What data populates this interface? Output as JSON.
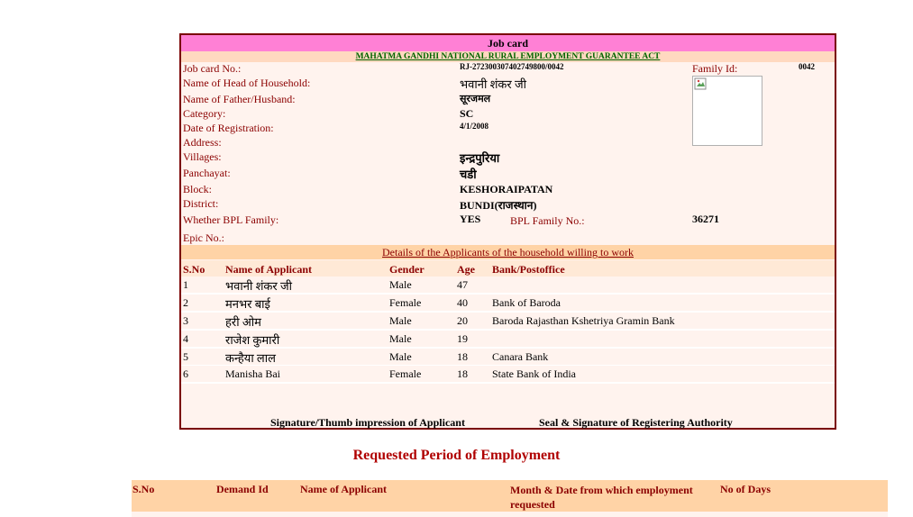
{
  "card": {
    "title": "Job card",
    "act": "MAHATMA GANDHI NATIONAL RURAL EMPLOYMENT GUARANTEE ACT",
    "labels": {
      "job_card_no": "Job card No.:",
      "head": "Name of Head of Household:",
      "father": "Name of Father/Husband:",
      "category": "Category:",
      "reg_date": "Date of Registration:",
      "address": "Address:",
      "villages": "Villages:",
      "panchayat": "Panchayat:",
      "block": "Block:",
      "district": "District:",
      "bpl": "Whether BPL Family:",
      "bpl_no": "BPL Family No.:",
      "epic": "Epic No.:",
      "family_id": "Family Id:"
    },
    "values": {
      "job_card_no": "RJ-272300307402749800/0042",
      "head": "भवानी शंकर जी",
      "father": "सूरजमल",
      "category": "SC",
      "reg_date": "4/1/2008",
      "villages": "इन्द्रपुरिया",
      "panchayat": "चडी",
      "block": "KESHORAIPATAN",
      "district": "BUNDI(राजस्थान)",
      "bpl": "YES",
      "bpl_no": "36271",
      "family_id": "0042"
    },
    "section_title": "Details of the Applicants of the household willing to work",
    "columns": [
      "S.No",
      "Name of Applicant",
      "Gender",
      "Age",
      "Bank/Postoffice"
    ],
    "applicants": [
      {
        "sno": "1",
        "name": "भवानी शंकर जी",
        "gender": "Male",
        "age": "47",
        "bank": ""
      },
      {
        "sno": "2",
        "name": "मनभर बाई",
        "gender": "Female",
        "age": "40",
        "bank": "Bank of Baroda"
      },
      {
        "sno": "3",
        "name": "हरी ओम",
        "gender": "Male",
        "age": "20",
        "bank": "Baroda Rajasthan Kshetriya Gramin Bank"
      },
      {
        "sno": "4",
        "name": "राजेश कुमारी",
        "gender": "Male",
        "age": "19",
        "bank": ""
      },
      {
        "sno": "5",
        "name": "कन्हैया लाल",
        "gender": "Male",
        "age": "18",
        "bank": "Canara Bank"
      },
      {
        "sno": "6",
        "name": "Manisha Bai",
        "gender": "Female",
        "age": "18",
        "bank": "State Bank of India"
      }
    ],
    "sig_applicant": "Signature/Thumb impression of Applicant",
    "sig_authority": "Seal & Signature of Registering Authority"
  },
  "employment": {
    "title": "Requested Period of Employment",
    "columns": [
      "S.No",
      "Demand Id",
      "Name of Applicant",
      "Month & Date from which employment requested",
      "No of Days"
    ]
  }
}
